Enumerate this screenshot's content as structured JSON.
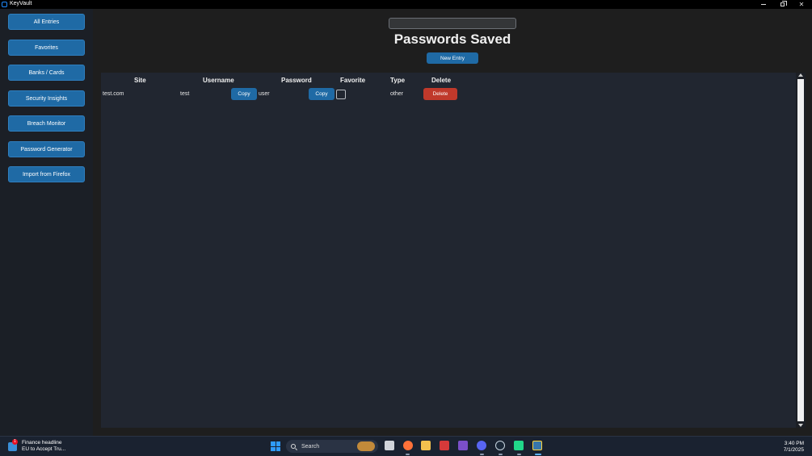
{
  "window": {
    "title": "KeyVault",
    "controls": {
      "minimize": "–",
      "maximize": "▢",
      "close": "✕"
    }
  },
  "sidebar": {
    "items": [
      {
        "label": "All Entries"
      },
      {
        "label": "Favorites"
      },
      {
        "label": "Banks / Cards"
      },
      {
        "label": "Security Insights"
      },
      {
        "label": "Breach Monitor"
      },
      {
        "label": "Password Generator"
      },
      {
        "label": "Import from Firefox"
      }
    ]
  },
  "main": {
    "search": {
      "value": "",
      "placeholder": ""
    },
    "title": "Passwords Saved",
    "new_entry_label": "New Entry",
    "table": {
      "headers": [
        "Site",
        "Username",
        "Password",
        "Favorite",
        "Type",
        "Delete"
      ],
      "rows": [
        {
          "site": "test.com",
          "username": "test",
          "username_copy_label": "Copy",
          "password": "user",
          "password_copy_label": "Copy",
          "favorite": false,
          "type": "other",
          "delete_label": "Delete"
        }
      ]
    }
  },
  "taskbar": {
    "news": {
      "badge": "1",
      "headline": "Finance headline",
      "subtext": "EU to Accept Tru..."
    },
    "search_label": "Search",
    "apps": [
      "task-view-icon",
      "firefox-icon",
      "file-explorer-icon",
      "red-app-icon",
      "visual-studio-icon",
      "discord-icon",
      "steam-icon",
      "pycharm-icon",
      "python-icon"
    ],
    "clock": {
      "time": "3:40 PM",
      "date": "7/1/2025"
    }
  },
  "colors": {
    "accent": "#1f6aa5",
    "danger": "#c0392b",
    "sidebar_bg": "#1b1f26",
    "main_bg": "#1e1e1e",
    "panel_bg": "#212630"
  }
}
